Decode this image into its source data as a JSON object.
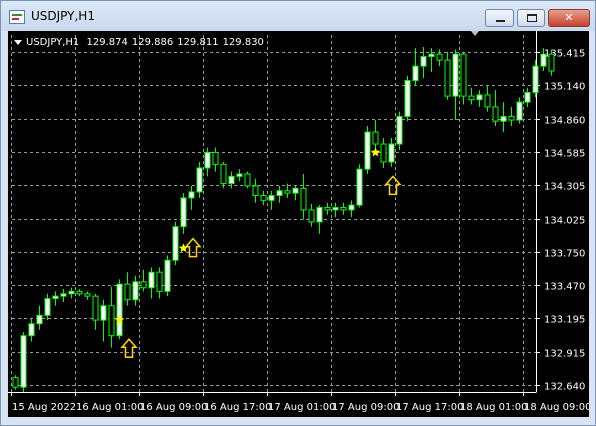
{
  "window": {
    "title": "USDJPY,H1",
    "minimize_label": "",
    "maximize_label": "",
    "close_label": "✕"
  },
  "chart_data": {
    "type": "candlestick",
    "symbol_info": "USDJPY,H1",
    "ohlc_values": [
      "129.874",
      "129.886",
      "129.811",
      "129.830"
    ],
    "y_ticks": [
      "135.415",
      "135.140",
      "134.860",
      "134.585",
      "134.305",
      "134.025",
      "133.750",
      "133.470",
      "133.195",
      "132.915",
      "132.640"
    ],
    "x_ticks": [
      "15 Aug 2022",
      "16 Aug 01:00",
      "16 Aug 09:00",
      "16 Aug 17:00",
      "17 Aug 01:00",
      "17 Aug 09:00",
      "17 Aug 17:00",
      "18 Aug 01:00",
      "18 Aug 09:00"
    ],
    "ylim": [
      132.58,
      135.56
    ],
    "colors": {
      "background": "#000000",
      "bull_body": "#ffffff",
      "bear_body": "#000000",
      "wick": "#00ff00",
      "grid": "#9a9a9a",
      "star": "#ffff00",
      "arrow": "#ffd700"
    },
    "candles": [
      [
        132.7,
        132.72,
        132.6,
        132.62
      ],
      [
        132.62,
        133.08,
        132.58,
        133.05
      ],
      [
        133.05,
        133.2,
        133.0,
        133.15
      ],
      [
        133.15,
        133.3,
        133.1,
        133.22
      ],
      [
        133.22,
        133.4,
        133.18,
        133.36
      ],
      [
        133.36,
        133.42,
        133.3,
        133.38
      ],
      [
        133.38,
        133.44,
        133.33,
        133.4
      ],
      [
        133.4,
        133.45,
        133.36,
        133.42
      ],
      [
        133.42,
        133.44,
        133.38,
        133.4
      ],
      [
        133.4,
        133.42,
        133.35,
        133.38
      ],
      [
        133.38,
        133.4,
        133.1,
        133.18
      ],
      [
        133.18,
        133.35,
        133.0,
        133.3
      ],
      [
        133.3,
        133.46,
        132.95,
        133.05
      ],
      [
        133.05,
        133.52,
        133.02,
        133.48
      ],
      [
        133.48,
        133.58,
        133.3,
        133.35
      ],
      [
        133.35,
        133.55,
        133.3,
        133.5
      ],
      [
        133.5,
        133.6,
        133.42,
        133.45
      ],
      [
        133.45,
        133.62,
        133.36,
        133.58
      ],
      [
        133.58,
        133.62,
        133.36,
        133.42
      ],
      [
        133.42,
        133.72,
        133.38,
        133.68
      ],
      [
        133.68,
        134.0,
        133.64,
        133.96
      ],
      [
        133.96,
        134.24,
        133.9,
        134.2
      ],
      [
        134.2,
        134.3,
        134.1,
        134.25
      ],
      [
        134.25,
        134.5,
        134.2,
        134.45
      ],
      [
        134.45,
        134.62,
        134.38,
        134.58
      ],
      [
        134.58,
        134.62,
        134.42,
        134.48
      ],
      [
        134.48,
        134.5,
        134.28,
        134.32
      ],
      [
        134.32,
        134.42,
        134.28,
        134.38
      ],
      [
        134.38,
        134.44,
        134.34,
        134.4
      ],
      [
        134.4,
        134.42,
        134.28,
        134.3
      ],
      [
        134.3,
        134.36,
        134.16,
        134.22
      ],
      [
        134.22,
        134.26,
        134.14,
        134.18
      ],
      [
        134.18,
        134.26,
        134.1,
        134.22
      ],
      [
        134.22,
        134.3,
        134.16,
        134.26
      ],
      [
        134.26,
        134.32,
        134.2,
        134.24
      ],
      [
        134.24,
        134.3,
        134.18,
        134.28
      ],
      [
        134.28,
        134.4,
        134.02,
        134.1
      ],
      [
        134.1,
        134.15,
        133.96,
        134.0
      ],
      [
        134.0,
        134.14,
        133.9,
        134.12
      ],
      [
        134.12,
        134.16,
        134.06,
        134.1
      ],
      [
        134.1,
        134.16,
        134.04,
        134.12
      ],
      [
        134.12,
        134.16,
        134.06,
        134.1
      ],
      [
        134.1,
        134.18,
        134.04,
        134.14
      ],
      [
        134.14,
        134.48,
        134.12,
        134.44
      ],
      [
        134.44,
        134.8,
        134.4,
        134.75
      ],
      [
        134.75,
        134.85,
        134.6,
        134.65
      ],
      [
        134.65,
        134.7,
        134.45,
        134.5
      ],
      [
        134.5,
        134.7,
        134.46,
        134.65
      ],
      [
        134.65,
        134.92,
        134.6,
        134.88
      ],
      [
        134.88,
        135.22,
        134.84,
        135.18
      ],
      [
        135.18,
        135.45,
        135.14,
        135.3
      ],
      [
        135.3,
        135.46,
        135.2,
        135.38
      ],
      [
        135.38,
        135.45,
        135.25,
        135.4
      ],
      [
        135.4,
        135.44,
        135.3,
        135.35
      ],
      [
        135.35,
        135.42,
        135.02,
        135.05
      ],
      [
        135.05,
        135.44,
        134.85,
        135.4
      ],
      [
        135.4,
        135.42,
        134.98,
        135.05
      ],
      [
        135.05,
        135.12,
        134.98,
        135.02
      ],
      [
        135.02,
        135.1,
        134.96,
        135.06
      ],
      [
        135.06,
        135.14,
        134.92,
        134.96
      ],
      [
        134.96,
        135.1,
        134.8,
        134.84
      ],
      [
        134.84,
        135.0,
        134.75,
        134.88
      ],
      [
        134.88,
        134.96,
        134.8,
        134.85
      ],
      [
        134.85,
        135.04,
        134.82,
        135.0
      ],
      [
        135.0,
        135.12,
        134.96,
        135.08
      ],
      [
        135.08,
        135.35,
        135.04,
        135.3
      ],
      [
        135.3,
        135.45,
        135.26,
        135.4
      ],
      [
        135.4,
        135.44,
        135.22,
        135.26
      ]
    ],
    "stars": [
      [
        13,
        133.18
      ],
      [
        21,
        133.78
      ],
      [
        45,
        134.58
      ]
    ],
    "arrows": [
      [
        14,
        133.02
      ],
      [
        22,
        133.86
      ],
      [
        47,
        134.38
      ]
    ],
    "peak_marker_index": 57
  }
}
